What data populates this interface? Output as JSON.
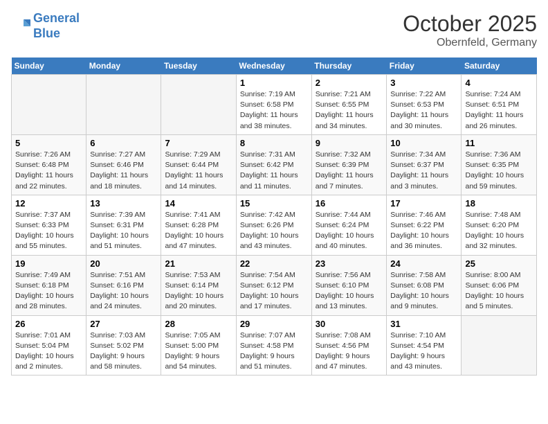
{
  "header": {
    "logo_line1": "General",
    "logo_line2": "Blue",
    "month": "October 2025",
    "location": "Obernfeld, Germany"
  },
  "days_of_week": [
    "Sunday",
    "Monday",
    "Tuesday",
    "Wednesday",
    "Thursday",
    "Friday",
    "Saturday"
  ],
  "weeks": [
    [
      {
        "num": "",
        "info": ""
      },
      {
        "num": "",
        "info": ""
      },
      {
        "num": "",
        "info": ""
      },
      {
        "num": "1",
        "info": "Sunrise: 7:19 AM\nSunset: 6:58 PM\nDaylight: 11 hours and 38 minutes."
      },
      {
        "num": "2",
        "info": "Sunrise: 7:21 AM\nSunset: 6:55 PM\nDaylight: 11 hours and 34 minutes."
      },
      {
        "num": "3",
        "info": "Sunrise: 7:22 AM\nSunset: 6:53 PM\nDaylight: 11 hours and 30 minutes."
      },
      {
        "num": "4",
        "info": "Sunrise: 7:24 AM\nSunset: 6:51 PM\nDaylight: 11 hours and 26 minutes."
      }
    ],
    [
      {
        "num": "5",
        "info": "Sunrise: 7:26 AM\nSunset: 6:48 PM\nDaylight: 11 hours and 22 minutes."
      },
      {
        "num": "6",
        "info": "Sunrise: 7:27 AM\nSunset: 6:46 PM\nDaylight: 11 hours and 18 minutes."
      },
      {
        "num": "7",
        "info": "Sunrise: 7:29 AM\nSunset: 6:44 PM\nDaylight: 11 hours and 14 minutes."
      },
      {
        "num": "8",
        "info": "Sunrise: 7:31 AM\nSunset: 6:42 PM\nDaylight: 11 hours and 11 minutes."
      },
      {
        "num": "9",
        "info": "Sunrise: 7:32 AM\nSunset: 6:39 PM\nDaylight: 11 hours and 7 minutes."
      },
      {
        "num": "10",
        "info": "Sunrise: 7:34 AM\nSunset: 6:37 PM\nDaylight: 11 hours and 3 minutes."
      },
      {
        "num": "11",
        "info": "Sunrise: 7:36 AM\nSunset: 6:35 PM\nDaylight: 10 hours and 59 minutes."
      }
    ],
    [
      {
        "num": "12",
        "info": "Sunrise: 7:37 AM\nSunset: 6:33 PM\nDaylight: 10 hours and 55 minutes."
      },
      {
        "num": "13",
        "info": "Sunrise: 7:39 AM\nSunset: 6:31 PM\nDaylight: 10 hours and 51 minutes."
      },
      {
        "num": "14",
        "info": "Sunrise: 7:41 AM\nSunset: 6:28 PM\nDaylight: 10 hours and 47 minutes."
      },
      {
        "num": "15",
        "info": "Sunrise: 7:42 AM\nSunset: 6:26 PM\nDaylight: 10 hours and 43 minutes."
      },
      {
        "num": "16",
        "info": "Sunrise: 7:44 AM\nSunset: 6:24 PM\nDaylight: 10 hours and 40 minutes."
      },
      {
        "num": "17",
        "info": "Sunrise: 7:46 AM\nSunset: 6:22 PM\nDaylight: 10 hours and 36 minutes."
      },
      {
        "num": "18",
        "info": "Sunrise: 7:48 AM\nSunset: 6:20 PM\nDaylight: 10 hours and 32 minutes."
      }
    ],
    [
      {
        "num": "19",
        "info": "Sunrise: 7:49 AM\nSunset: 6:18 PM\nDaylight: 10 hours and 28 minutes."
      },
      {
        "num": "20",
        "info": "Sunrise: 7:51 AM\nSunset: 6:16 PM\nDaylight: 10 hours and 24 minutes."
      },
      {
        "num": "21",
        "info": "Sunrise: 7:53 AM\nSunset: 6:14 PM\nDaylight: 10 hours and 20 minutes."
      },
      {
        "num": "22",
        "info": "Sunrise: 7:54 AM\nSunset: 6:12 PM\nDaylight: 10 hours and 17 minutes."
      },
      {
        "num": "23",
        "info": "Sunrise: 7:56 AM\nSunset: 6:10 PM\nDaylight: 10 hours and 13 minutes."
      },
      {
        "num": "24",
        "info": "Sunrise: 7:58 AM\nSunset: 6:08 PM\nDaylight: 10 hours and 9 minutes."
      },
      {
        "num": "25",
        "info": "Sunrise: 8:00 AM\nSunset: 6:06 PM\nDaylight: 10 hours and 5 minutes."
      }
    ],
    [
      {
        "num": "26",
        "info": "Sunrise: 7:01 AM\nSunset: 5:04 PM\nDaylight: 10 hours and 2 minutes."
      },
      {
        "num": "27",
        "info": "Sunrise: 7:03 AM\nSunset: 5:02 PM\nDaylight: 9 hours and 58 minutes."
      },
      {
        "num": "28",
        "info": "Sunrise: 7:05 AM\nSunset: 5:00 PM\nDaylight: 9 hours and 54 minutes."
      },
      {
        "num": "29",
        "info": "Sunrise: 7:07 AM\nSunset: 4:58 PM\nDaylight: 9 hours and 51 minutes."
      },
      {
        "num": "30",
        "info": "Sunrise: 7:08 AM\nSunset: 4:56 PM\nDaylight: 9 hours and 47 minutes."
      },
      {
        "num": "31",
        "info": "Sunrise: 7:10 AM\nSunset: 4:54 PM\nDaylight: 9 hours and 43 minutes."
      },
      {
        "num": "",
        "info": ""
      }
    ]
  ]
}
